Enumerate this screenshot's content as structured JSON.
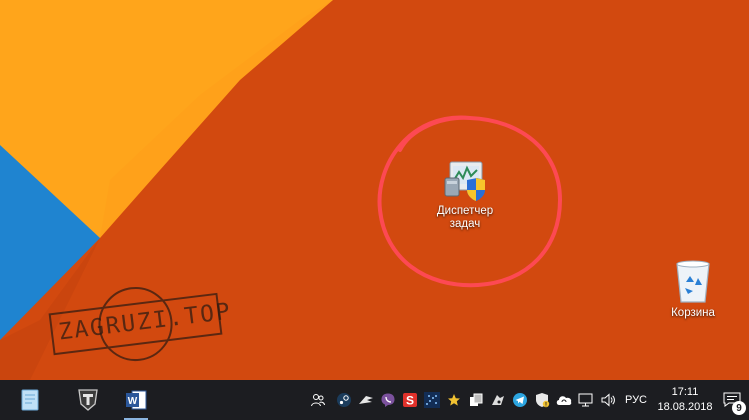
{
  "desktop": {
    "icons": [
      {
        "label": "Диспетчер\nзадач",
        "icon": "task-manager-icon"
      },
      {
        "label": "Корзина",
        "icon": "recycle-bin-icon"
      }
    ],
    "watermark": "ZAGRUZI.TOP",
    "colors": {
      "background": "#d2490f",
      "highlight_ring": "#ff4a57",
      "yellow": "#ffa11a",
      "blue": "#1f84d0"
    }
  },
  "taskbar": {
    "apps": [
      "notepad-app-icon",
      "world-of-tanks-icon",
      "word-icon"
    ],
    "tray_icons": [
      "people-icon",
      "steam-icon",
      "wings-icon",
      "viber-icon",
      "shield-s-icon",
      "dots-app-icon",
      "star-icon",
      "copy-icon",
      "game-icon",
      "telegram-icon",
      "security-icon",
      "cloud-sync-icon",
      "network-icon",
      "volume-icon"
    ],
    "language": "РУС",
    "time": "17:11",
    "date": "18.08.2018",
    "notifications_count": "9"
  }
}
